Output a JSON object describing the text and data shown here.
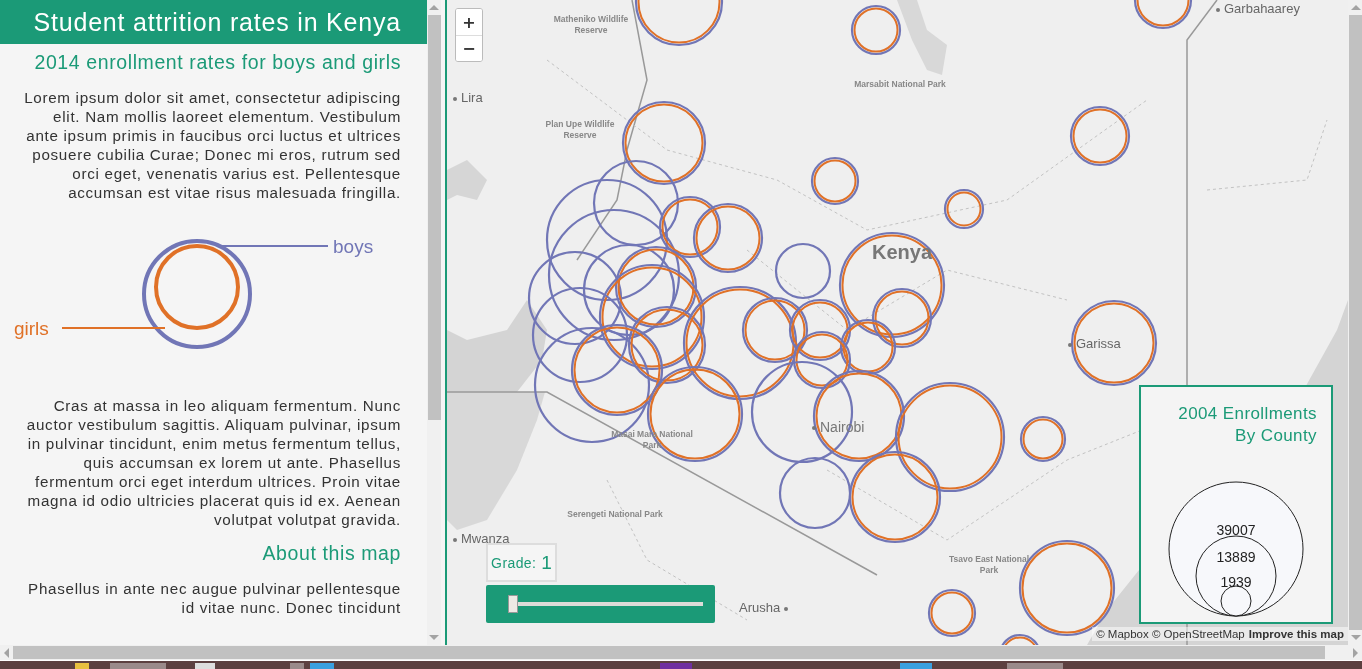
{
  "sidebar": {
    "title": "Student attrition rates in Kenya",
    "blocks": [
      {
        "kind": "heading",
        "text": "2014 enrollment rates for boys and girls"
      },
      {
        "kind": "paragraph",
        "text": "Lorem ipsum dolor sit amet, consectetur adipiscing elit. Nam mollis laoreet elementum. Vestibulum ante ipsum primis in faucibus orci luctus et ultrices posuere cubilia Curae; Donec mi eros, rutrum sed orci eget, venenatis varius est. Pellentesque accumsan est vitae risus malesuada fringilla."
      },
      {
        "kind": "legend",
        "items": [
          {
            "label": "boys",
            "color": "#7176b6"
          },
          {
            "label": "girls",
            "color": "#e07127"
          }
        ]
      },
      {
        "kind": "paragraph",
        "text": "Cras at massa in leo aliquam fermentum. Nunc auctor vestibulum sagittis. Aliquam pulvinar, ipsum in pulvinar tincidunt, enim metus fermentum tellus, quis accumsan ex lorem ut ante. Phasellus fermentum orci eget interdum ultrices. Proin vitae magna id odio ultricies placerat quis id ex. Aenean volutpat volutpat gravida."
      },
      {
        "kind": "heading",
        "text": "About this map"
      },
      {
        "kind": "paragraph",
        "text": "Phasellus in ante nec augue pulvinar pellentesque id vitae nunc. Donec tincidunt"
      }
    ]
  },
  "map": {
    "zoom_controls": [
      "+",
      "−"
    ],
    "labels": [
      {
        "text": "Matheniko Wildlife Reserve",
        "kind": "park"
      },
      {
        "text": "Lira",
        "kind": "town"
      },
      {
        "text": "Plan Upe Wildlife Reserve",
        "kind": "park"
      },
      {
        "text": "Marsabit National Park",
        "kind": "park"
      },
      {
        "text": "Garbahaarey",
        "kind": "town"
      },
      {
        "text": "Kenya",
        "kind": "country"
      },
      {
        "text": "Garissa",
        "kind": "town"
      },
      {
        "text": "Nairobi",
        "kind": "capital"
      },
      {
        "text": "Masai Mara National Park",
        "kind": "park"
      },
      {
        "text": "Serengeti National Park",
        "kind": "park"
      },
      {
        "text": "Mwanza",
        "kind": "town"
      },
      {
        "text": "Tsavo East National Park",
        "kind": "park"
      },
      {
        "text": "Arusha",
        "kind": "town"
      }
    ],
    "grade_control": {
      "label": "Grade:",
      "value": "1",
      "level": 0
    },
    "legend": {
      "title": "2004 Enrollments By County",
      "values": [
        "39007",
        "13889",
        "1939"
      ]
    },
    "attribution": {
      "text": "© Mapbox © OpenStreetMap",
      "link": "Improve this map"
    }
  }
}
